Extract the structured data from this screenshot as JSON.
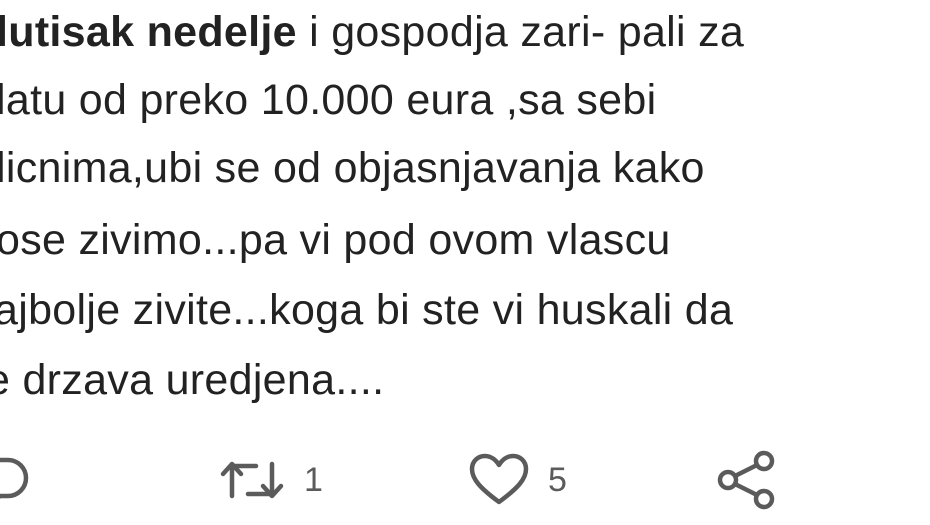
{
  "tweet": {
    "lines": [
      {
        "bold": "lutisak nedelje",
        "text": " i gospodja zari- pali za"
      },
      {
        "bold": "",
        "text": "latu od preko 10.000 eura ,sa sebi"
      },
      {
        "bold": "",
        "text": "licnima,ubi se od objasnjavanja kako"
      },
      {
        "bold": "",
        "text": "ose zivimo...pa vi pod ovom vlascu"
      },
      {
        "bold": "",
        "text": "ajbolje zivite...koga bi ste vi huskali da"
      },
      {
        "bold": "",
        "text": "e drzava uredjena...."
      }
    ]
  },
  "actions": {
    "reply": {
      "icon": "reply-icon"
    },
    "retweet": {
      "icon": "retweet-icon",
      "count": "1"
    },
    "like": {
      "icon": "heart-icon",
      "count": "5"
    },
    "share": {
      "icon": "share-icon"
    }
  },
  "colors": {
    "text": "#222222",
    "icon": "#5b5b5b"
  }
}
